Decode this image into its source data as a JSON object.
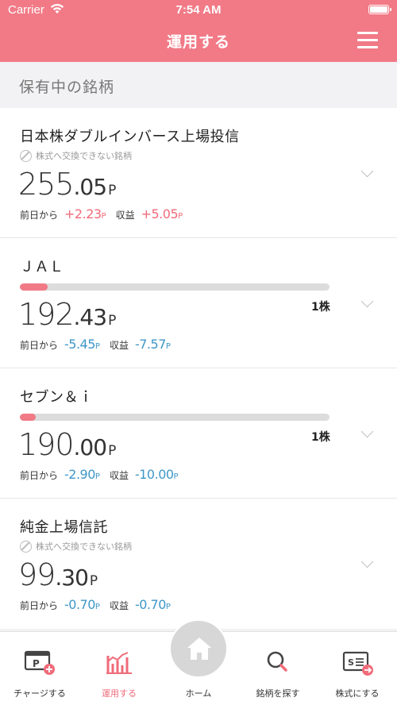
{
  "status": {
    "carrier": "Carrier",
    "time": "7:54 AM"
  },
  "header": {
    "title": "運用する"
  },
  "section": {
    "title": "保有中の銘柄"
  },
  "labels": {
    "prev_day": "前日から",
    "profit": "収益",
    "unit": "P"
  },
  "holdings": [
    {
      "name": "日本株ダブルインバース上場投信",
      "note": "株式へ交換できない銘柄",
      "price_int": "255",
      "price_dec": ".05",
      "change": "+2.23",
      "profit": "+5.05",
      "trend": "positive",
      "shares": ""
    },
    {
      "name": "ＪＡＬ",
      "progress": 0.09,
      "price_int": "192",
      "price_dec": ".43",
      "change": "-5.45",
      "profit": "-7.57",
      "trend": "negative",
      "shares": "1株"
    },
    {
      "name": "セブン＆ｉ",
      "progress": 0.05,
      "price_int": "190",
      "price_dec": ".00",
      "change": "-2.90",
      "profit": "-10.00",
      "trend": "negative",
      "shares": "1株"
    },
    {
      "name": "純金上場信託",
      "note": "株式へ交換できない銘柄",
      "price_int": "99",
      "price_dec": ".30",
      "change": "-0.70",
      "profit": "-0.70",
      "trend": "negative",
      "shares": ""
    }
  ],
  "tabs": [
    {
      "label": "チャージする",
      "icon": "charge-icon",
      "active": false
    },
    {
      "label": "運用する",
      "icon": "chart-icon",
      "active": true
    },
    {
      "label": "ホーム",
      "icon": "home-icon",
      "active": false
    },
    {
      "label": "銘柄を探す",
      "icon": "search-icon",
      "active": false
    },
    {
      "label": "株式にする",
      "icon": "stock-exchange-icon",
      "active": false
    }
  ],
  "colors": {
    "accent": "#f17a86",
    "positive": "#f06b7a",
    "negative": "#3e97c9"
  }
}
